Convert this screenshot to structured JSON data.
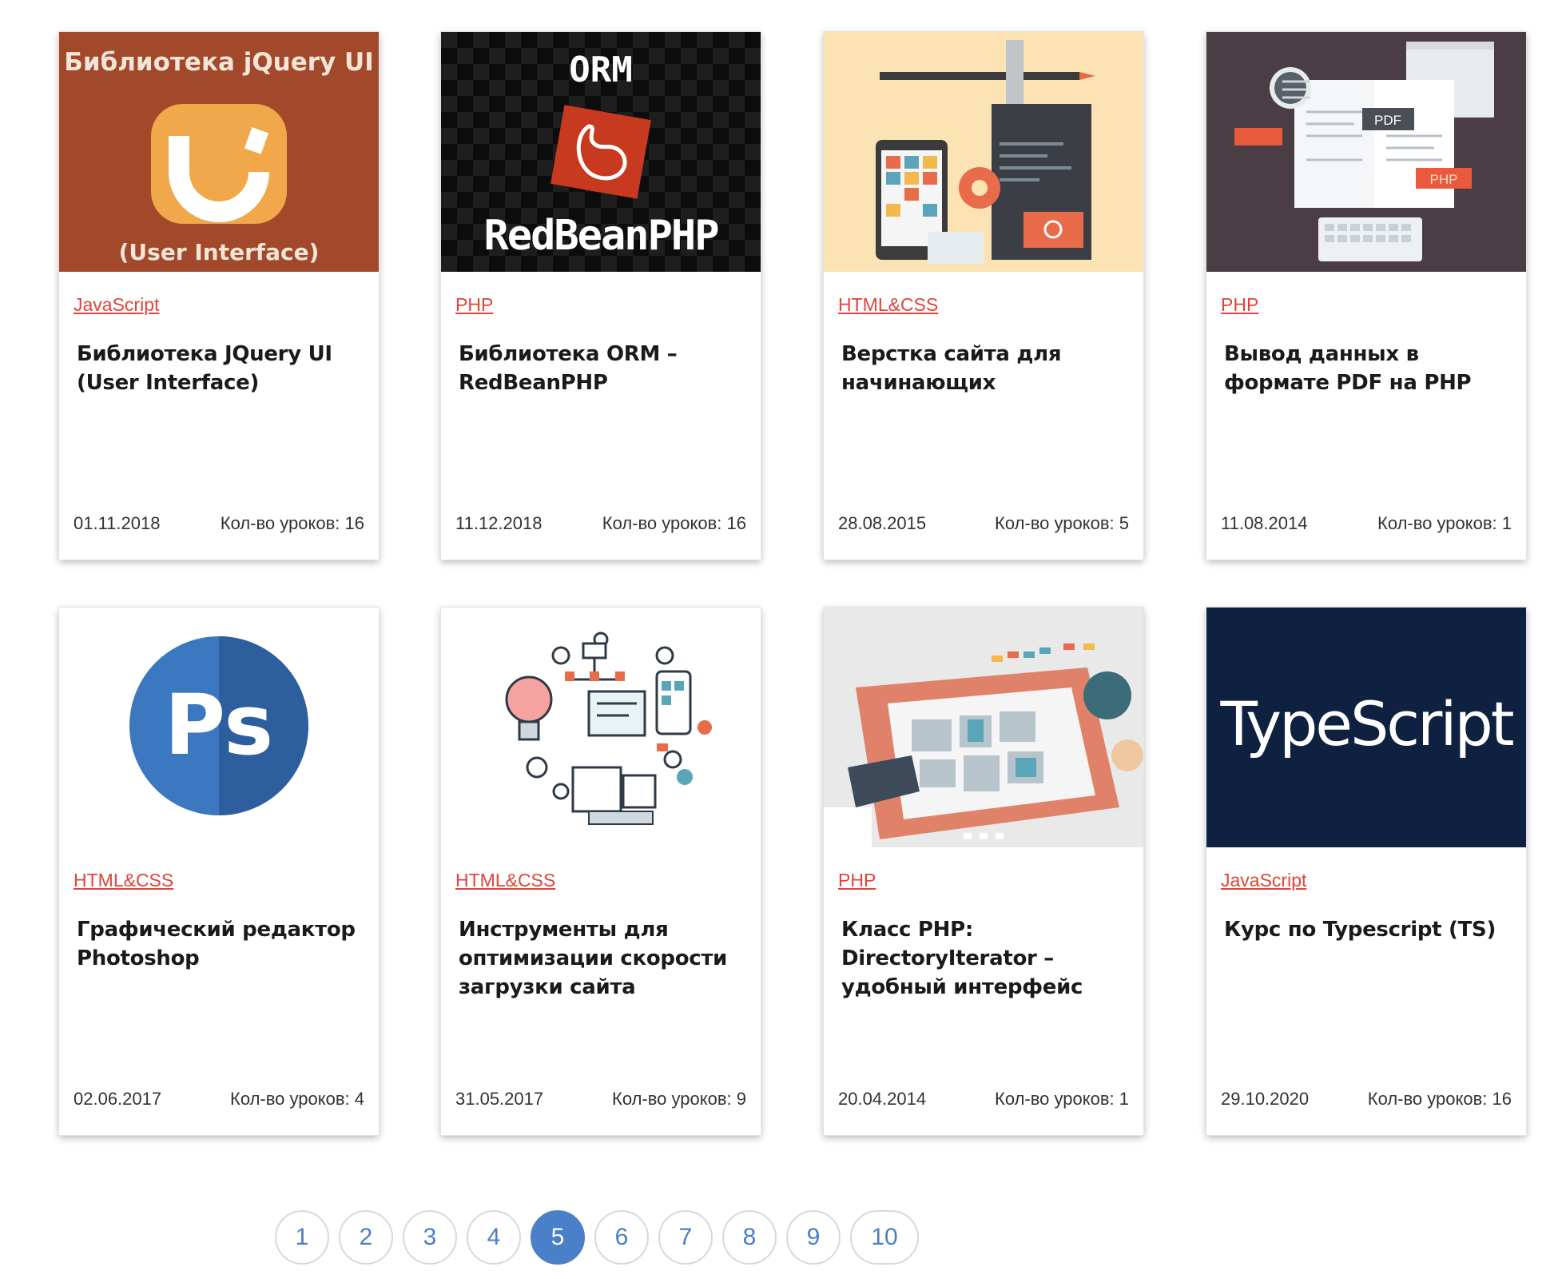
{
  "cards": [
    {
      "category": "JavaScript",
      "title": "Библиотека JQuery UI (User Interface)",
      "date": "01.11.2018",
      "lessons": "Кол-во уроков: 16",
      "thumb": {
        "line1": "Библиотека jQuery UI",
        "line2": "(User Interface)",
        "bg": "#a2492c"
      }
    },
    {
      "category": "PHP",
      "title": "Библиотека ORM – RedBeanPHP",
      "date": "11.12.2018",
      "lessons": "Кол-во уроков: 16",
      "thumb": {
        "line1": "ORM",
        "line2": "RedBeanPHP",
        "bg": "#111111"
      }
    },
    {
      "category": "HTML&CSS",
      "title": "Верстка сайта для начинающих",
      "date": "28.08.2015",
      "lessons": "Кол-во уроков: 5",
      "thumb": {
        "bg": "#fbe3b4"
      }
    },
    {
      "category": "PHP",
      "title": "Вывод данных в формате PDF на PHP",
      "date": "11.08.2014",
      "lessons": "Кол-во уроков: 1",
      "thumb": {
        "label1": "PDF",
        "label2": "PHP",
        "bg": "#4a3d44"
      }
    },
    {
      "category": "HTML&CSS",
      "title": "Графический редактор Photoshop",
      "date": "02.06.2017",
      "lessons": "Кол-во уроков: 4",
      "thumb": {
        "text": "Ps",
        "bg": "#ffffff"
      }
    },
    {
      "category": "HTML&CSS",
      "title": "Инструменты для оптимизации скорости загрузки сайта",
      "date": "31.05.2017",
      "lessons": "Кол-во уроков: 9",
      "thumb": {
        "bg": "#ffffff"
      }
    },
    {
      "category": "PHP",
      "title": "Класс PHP: DirectoryIterator – удобный интерфейс",
      "date": "20.04.2014",
      "lessons": "Кол-во уроков: 1",
      "thumb": {
        "bg": "#e9e9e9"
      }
    },
    {
      "category": "JavaScript",
      "title": "Курс по Typescript (TS)",
      "date": "29.10.2020",
      "lessons": "Кол-во уроков: 16",
      "thumb": {
        "text": "TypeScript",
        "bg": "#0f2140"
      }
    }
  ],
  "pagination": {
    "pages": [
      "1",
      "2",
      "3",
      "4",
      "5",
      "6",
      "7",
      "8",
      "9",
      "10"
    ],
    "current": "5"
  },
  "colors": {
    "category_link": "#e0443a",
    "pager_active": "#4a80c8",
    "pager_text": "#4a7fc1"
  }
}
